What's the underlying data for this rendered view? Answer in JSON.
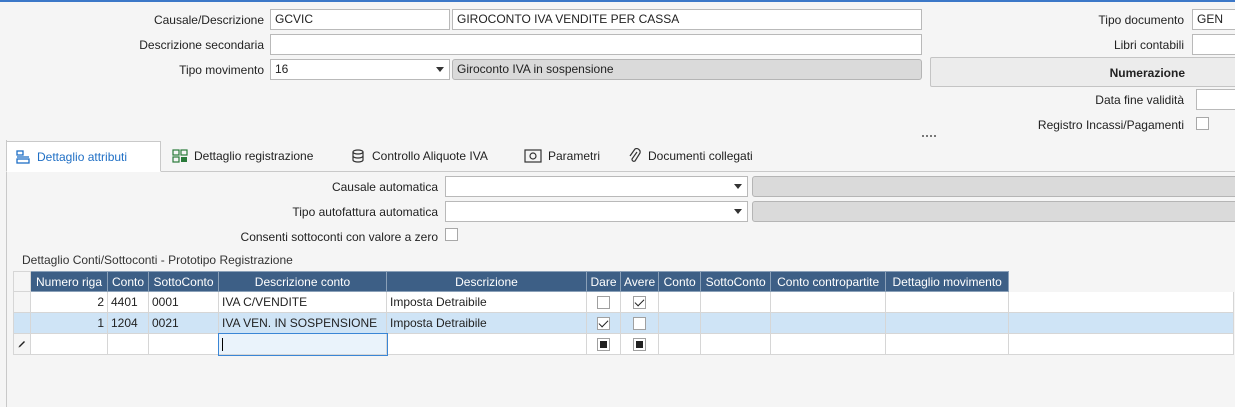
{
  "header": {
    "causale_label": "Causale/Descrizione",
    "causale_code": "GCVIC",
    "causale_desc": "GIROCONTO IVA VENDITE PER CASSA",
    "desc_sec_label": "Descrizione secondaria",
    "desc_sec_value": "",
    "tipo_mov_label": "Tipo movimento",
    "tipo_mov_value": "16",
    "tipo_mov_desc": "Giroconto IVA in sospensione",
    "tipo_doc_label": "Tipo documento",
    "tipo_doc_value": "GEN",
    "libri_label": "Libri contabili",
    "libri_value": "",
    "numerazione_label": "Numerazione",
    "data_fine_label": "Data fine validità",
    "data_fine_value": "",
    "registro_label": "Registro Incassi/Pagamenti"
  },
  "tabs": [
    {
      "label": "Dettaglio attributi",
      "icon": "attributes-icon",
      "active": true
    },
    {
      "label": "Dettaglio registrazione",
      "icon": "registration-grid-icon",
      "active": false
    },
    {
      "label": "Controllo Aliquote IVA",
      "icon": "coins-icon",
      "active": false
    },
    {
      "label": "Parametri",
      "icon": "parameters-icon",
      "active": false
    },
    {
      "label": "Documenti collegati",
      "icon": "paperclip-icon",
      "active": false
    }
  ],
  "attributes": {
    "causale_auto_label": "Causale automatica",
    "causale_auto_value": "",
    "tipo_autofatt_label": "Tipo autofattura automatica",
    "tipo_autofatt_value": "",
    "consenti_label": "Consenti sottoconti con valore a zero"
  },
  "grid": {
    "section_label": "Dettaglio Conti/Sottoconti - Prototipo Registrazione",
    "columns": [
      "Numero riga",
      "Conto",
      "SottoConto",
      "Descrizione conto",
      "Descrizione",
      "Dare",
      "Avere",
      "Conto",
      "SottoConto",
      "Conto contropartite",
      "Dettaglio movimento"
    ],
    "rows": [
      {
        "numero": "2",
        "conto": "4401",
        "sottoconto": "0001",
        "desc_conto": "IVA C/VENDITE",
        "descrizione": "Imposta Detraibile",
        "dare": false,
        "avere": true
      },
      {
        "numero": "1",
        "conto": "1204",
        "sottoconto": "0021",
        "desc_conto": "IVA VEN. IN SOSPENSIONE",
        "descrizione": "Imposta Detraibile",
        "dare": true,
        "avere": false
      }
    ]
  },
  "colors": {
    "accent": "#1f6fc5",
    "grid_header": "#3d5f86",
    "selected_row": "#cfe4f6"
  }
}
